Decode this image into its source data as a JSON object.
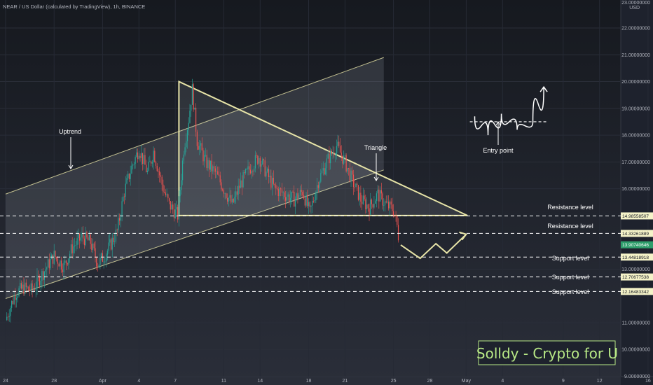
{
  "header": {
    "symbol_title": "NEAR / US Dollar (calculated by TradingView), 1h, BINANCE"
  },
  "price_axis": {
    "currency_top": "23.00000000",
    "currency": "USD",
    "ticks": [
      "22.00000000",
      "21.00000000",
      "20.00000000",
      "19.00000000",
      "18.00000000",
      "17.00000000",
      "16.00000000",
      "13.00000000",
      "11.00000000",
      "10.00000000",
      "9.00000000"
    ]
  },
  "time_axis": {
    "ticks": [
      {
        "label": "24",
        "day": 0
      },
      {
        "label": "28",
        "day": 4
      },
      {
        "label": "Apr",
        "day": 8
      },
      {
        "label": "4",
        "day": 11
      },
      {
        "label": "7",
        "day": 14
      },
      {
        "label": "11",
        "day": 18
      },
      {
        "label": "14",
        "day": 21
      },
      {
        "label": "18",
        "day": 25
      },
      {
        "label": "21",
        "day": 28
      },
      {
        "label": "25",
        "day": 32
      },
      {
        "label": "28",
        "day": 35
      },
      {
        "label": "May",
        "day": 38
      },
      {
        "label": "4",
        "day": 41
      },
      {
        "label": "9",
        "day": 46
      },
      {
        "label": "12",
        "day": 49
      },
      {
        "label": "16",
        "day": 53
      }
    ]
  },
  "annotations": {
    "uptrend": "Uptrend",
    "triangle": "Triangle",
    "entry_point": "Entry point",
    "resistance_1": "Resistance level",
    "resistance_2": "Resistance level",
    "support_1": "Support level",
    "support_2": "Support level",
    "support_3": "Support level"
  },
  "branding": {
    "text": "Solldy - Crypto for U"
  },
  "colors": {
    "background": "#1e222d",
    "candle_up": "#26a69a",
    "candle_down": "#ef5350",
    "pattern_line": "#e8e5a8",
    "current_price_tag": "#2e9e6b",
    "level_tag": "#f5f3c8",
    "brand_text": "#b8e986"
  },
  "chart_data": {
    "type": "candlestick",
    "ylim": [
      9,
      23
    ],
    "price_levels": [
      {
        "name": "Resistance level",
        "value": "14.98558507"
      },
      {
        "name": "Resistance level",
        "value": "14.33261889"
      },
      {
        "name": "current",
        "value": "13.90740646"
      },
      {
        "name": "Support level",
        "value": "13.44818918"
      },
      {
        "name": "Support level",
        "value": "12.70677538"
      },
      {
        "name": "Support level",
        "value": "12.16483342"
      }
    ],
    "close_path": [
      {
        "day": 0,
        "close": 11.1
      },
      {
        "day": 0.8,
        "close": 12.1
      },
      {
        "day": 1.5,
        "close": 12.3
      },
      {
        "day": 2.2,
        "close": 12.2
      },
      {
        "day": 3,
        "close": 12.8
      },
      {
        "day": 4,
        "close": 13.5
      },
      {
        "day": 4.8,
        "close": 13.1
      },
      {
        "day": 5.5,
        "close": 13.8
      },
      {
        "day": 6.3,
        "close": 14.2
      },
      {
        "day": 7,
        "close": 14.0
      },
      {
        "day": 7.6,
        "close": 13.2
      },
      {
        "day": 8.3,
        "close": 13.6
      },
      {
        "day": 9.2,
        "close": 14.4
      },
      {
        "day": 9.8,
        "close": 15.9
      },
      {
        "day": 10.4,
        "close": 16.8
      },
      {
        "day": 11,
        "close": 17.5
      },
      {
        "day": 11.7,
        "close": 16.6
      },
      {
        "day": 12.2,
        "close": 17.4
      },
      {
        "day": 13,
        "close": 16.0
      },
      {
        "day": 13.5,
        "close": 15.4
      },
      {
        "day": 14.2,
        "close": 15.0
      },
      {
        "day": 14.7,
        "close": 17.5
      },
      {
        "day": 15.1,
        "close": 18.6
      },
      {
        "day": 15.4,
        "close": 19.7
      },
      {
        "day": 15.8,
        "close": 17.8
      },
      {
        "day": 16.5,
        "close": 17.0
      },
      {
        "day": 17.3,
        "close": 16.6
      },
      {
        "day": 18,
        "close": 16.0
      },
      {
        "day": 18.7,
        "close": 15.4
      },
      {
        "day": 19.4,
        "close": 16.2
      },
      {
        "day": 20.2,
        "close": 16.8
      },
      {
        "day": 20.9,
        "close": 17.2
      },
      {
        "day": 21.5,
        "close": 16.6
      },
      {
        "day": 22.2,
        "close": 16.0
      },
      {
        "day": 23,
        "close": 15.8
      },
      {
        "day": 23.8,
        "close": 15.6
      },
      {
        "day": 24.5,
        "close": 15.9
      },
      {
        "day": 25.1,
        "close": 15.1
      },
      {
        "day": 25.8,
        "close": 16.3
      },
      {
        "day": 26.6,
        "close": 17.1
      },
      {
        "day": 27.3,
        "close": 17.6
      },
      {
        "day": 28,
        "close": 17.0
      },
      {
        "day": 28.6,
        "close": 16.3
      },
      {
        "day": 29.3,
        "close": 15.6
      },
      {
        "day": 30,
        "close": 15.3
      },
      {
        "day": 30.7,
        "close": 15.8
      },
      {
        "day": 31.4,
        "close": 15.4
      },
      {
        "day": 32,
        "close": 15.2
      },
      {
        "day": 32.3,
        "close": 14.6
      },
      {
        "day": 32.5,
        "close": 13.9
      }
    ],
    "projection_path": [
      {
        "day": 32.6,
        "price": 13.9
      },
      {
        "day": 34.2,
        "price": 13.4
      },
      {
        "day": 35.5,
        "price": 13.95
      },
      {
        "day": 36.4,
        "price": 13.6
      },
      {
        "day": 38.0,
        "price": 14.3
      }
    ],
    "channel_lines": [
      [
        {
          "day": 0,
          "price": 15.8
        },
        {
          "day": 31.2,
          "price": 20.9
        }
      ],
      [
        {
          "day": 0,
          "price": 11.9
        },
        {
          "day": 31.2,
          "price": 16.7
        }
      ]
    ],
    "triangle_vertices": [
      {
        "day": 14.3,
        "price": 20.0
      },
      {
        "day": 38.1,
        "price": 15.0
      },
      {
        "day": 14.3,
        "price": 15.0
      }
    ],
    "entry_sketch": [
      {
        "day": 38.7,
        "price": 18.7
      },
      {
        "day": 39.8,
        "price": 18.0
      },
      {
        "day": 40.9,
        "price": 18.8
      },
      {
        "day": 42.2,
        "price": 18.2
      },
      {
        "day": 43.5,
        "price": 18.5
      },
      {
        "day": 44.4,
        "price": 19.8
      }
    ]
  }
}
